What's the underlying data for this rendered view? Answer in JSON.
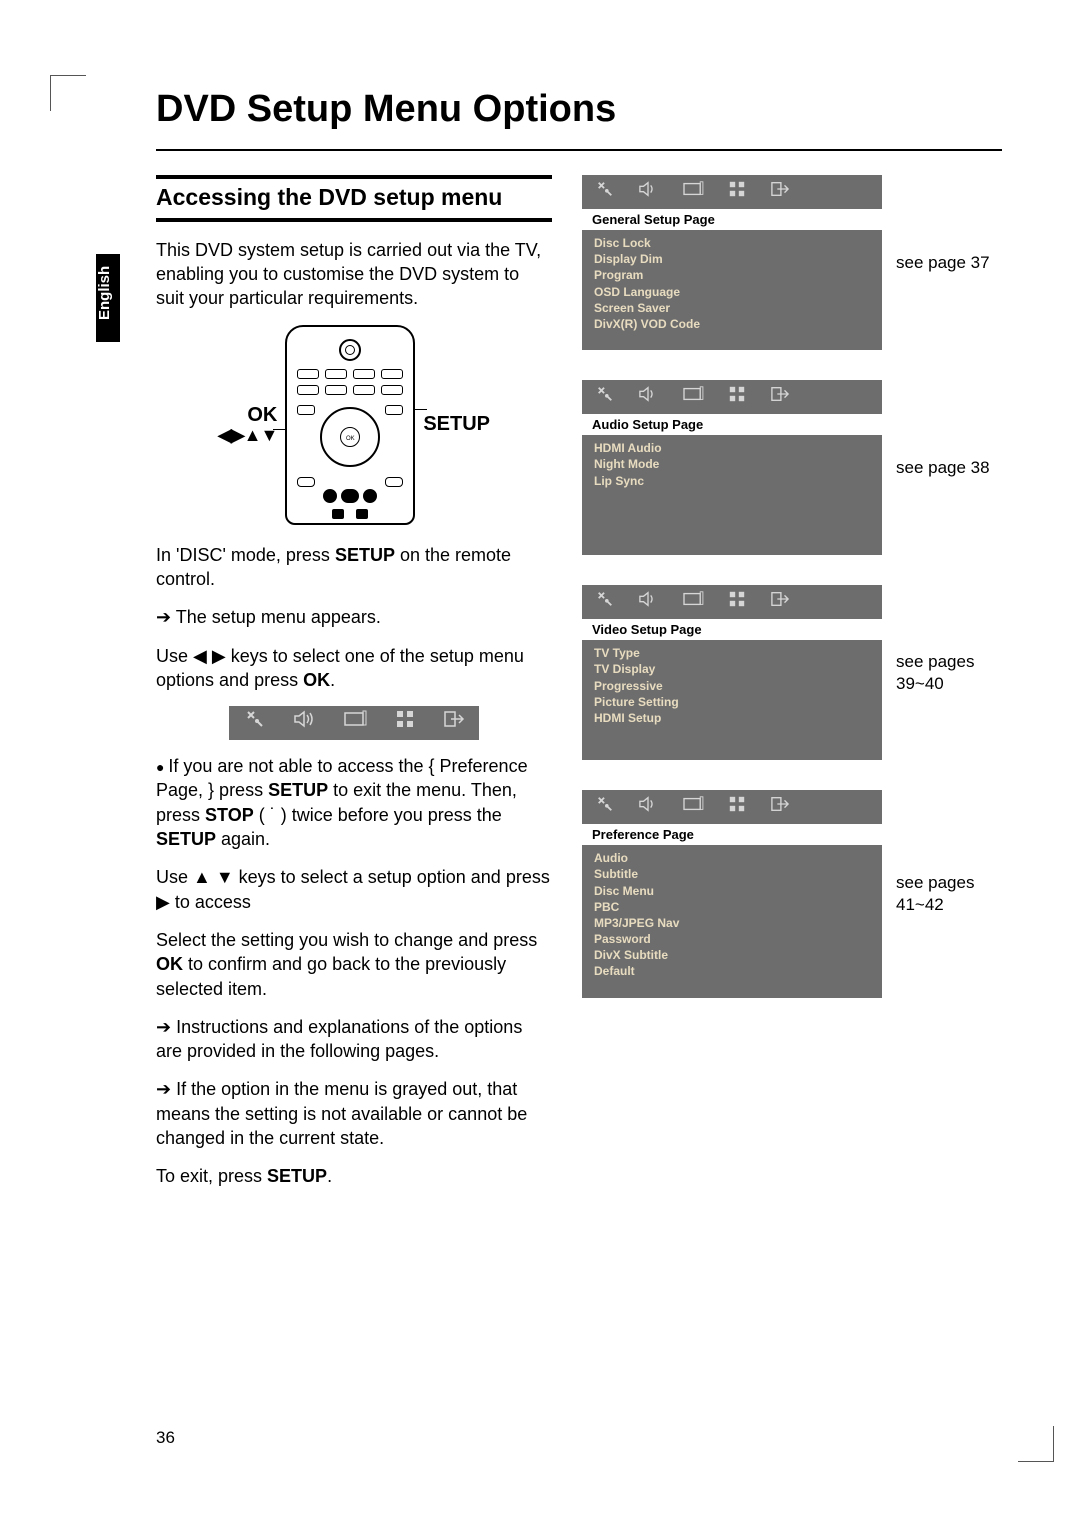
{
  "language_tab": "English",
  "page_title": "DVD Setup Menu Options",
  "section_heading": "Accessing the DVD setup menu",
  "intro": "This DVD system setup is carried out via the TV, enabling you to customise the DVD system to suit your particular requirements.",
  "remote": {
    "ok_label": "OK",
    "setup_label": "SETUP",
    "nav_arrows": "◀▶▲▼"
  },
  "steps": {
    "s1a": "In 'DISC' mode, press ",
    "s1b": "SETUP",
    "s1c": " on the remote control.",
    "s1_res": "The setup menu appears.",
    "s2a": "Use ◀ ▶ keys to select one of the setup menu options and press ",
    "s2b": "OK",
    "s2c": ".",
    "s3a": "If you are not able to access the { Preference Page, } press ",
    "s3b": "SETUP",
    "s3c": " to exit the menu.  Then, press ",
    "s3d": "STOP",
    "s3e": " ( ˙  ) twice before you press the ",
    "s3f": "SETUP",
    "s3g": " again.",
    "s4": "Use ▲ ▼ keys to select a setup option and press ▶ to access",
    "s5a": "Select the setting you wish to change and press ",
    "s5b": "OK",
    "s5c": " to confirm and go back to the previously selected item.",
    "s5_res": "Instructions and explanations of the options are provided in the following pages.",
    "s5_res2": "If the option in the menu is grayed out, that means the setting is not available or cannot be changed in the current state.",
    "s6a": "To exit, press ",
    "s6b": "SETUP",
    "s6c": "."
  },
  "menus": [
    {
      "title": "General Setup Page",
      "items": [
        "Disc Lock",
        "Display Dim",
        "Program",
        "OSD Language",
        "Screen Saver",
        "DivX(R) VOD Code"
      ],
      "ref": "see page 37"
    },
    {
      "title": "Audio Setup Page",
      "items": [
        "HDMI Audio",
        "Night Mode",
        "Lip Sync"
      ],
      "ref": "see page 38"
    },
    {
      "title": "Video Setup Page",
      "items": [
        "TV Type",
        "TV Display",
        "Progressive",
        "Picture Setting",
        "HDMI Setup"
      ],
      "ref": "see pages 39~40"
    },
    {
      "title": "Preference Page",
      "items": [
        "Audio",
        "Subtitle",
        "Disc Menu",
        "PBC",
        "MP3/JPEG Nav",
        "Password",
        "DivX Subtitle",
        "Default"
      ],
      "ref": "see pages 41~42"
    }
  ],
  "icons": {
    "tools": "✕",
    "speaker": "🔊",
    "display": "▭",
    "pixels": "◫",
    "exit": "➦"
  },
  "page_number": "36"
}
